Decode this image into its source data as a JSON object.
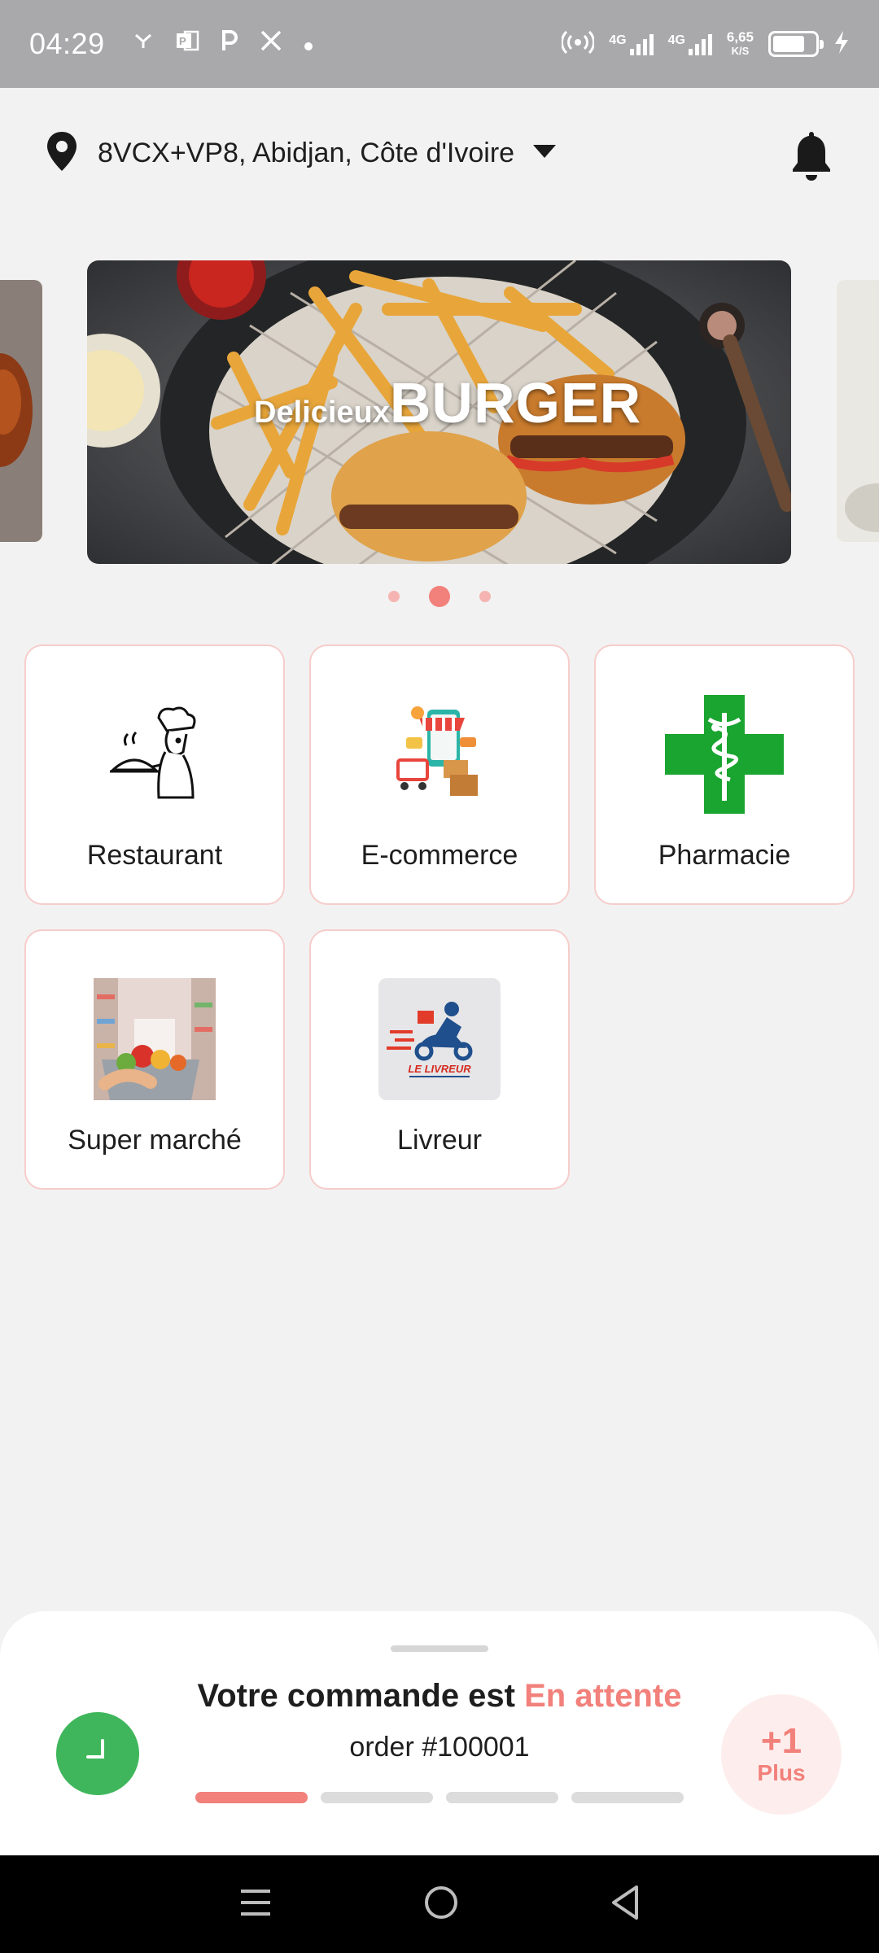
{
  "status_bar": {
    "time": "04:29",
    "network_1": "4G",
    "network_2": "4G",
    "speed_value": "6,65",
    "speed_unit": "K/S",
    "battery_percent": 75
  },
  "header": {
    "location": "8VCX+VP8, Abidjan, Côte d'Ivoire"
  },
  "carousel": {
    "banner_word_small": "Delicieux",
    "banner_word_big": "BURGER",
    "slide_count": 3,
    "active_slide": 2
  },
  "categories": [
    {
      "label": "Restaurant",
      "icon": "chef-icon"
    },
    {
      "label": "E-commerce",
      "icon": "shopping-phone-icon"
    },
    {
      "label": "Pharmacie",
      "icon": "pharmacy-cross-icon"
    },
    {
      "label": "Super marché",
      "icon": "supermarket-cart-icon"
    },
    {
      "label": "Livreur",
      "icon": "delivery-scooter-icon"
    }
  ],
  "livreur_logo_text": "LE LIVREUR",
  "order": {
    "title_prefix": "Votre commande est",
    "status": "En attente",
    "number": "order #100001",
    "progress_steps_total": 4,
    "progress_steps_done": 1
  },
  "more_button": {
    "count": "+1",
    "label": "Plus"
  },
  "colors": {
    "accent": "#f2807b",
    "status_bar": "#a9a8aa",
    "clock_button": "#3fb65b",
    "pharmacy_green": "#1aa531"
  }
}
